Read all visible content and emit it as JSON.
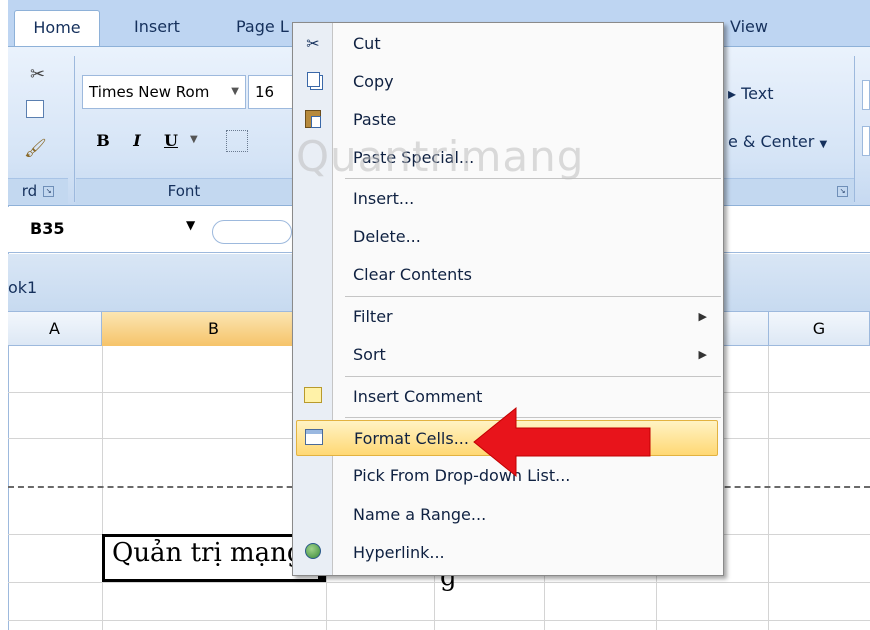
{
  "ribbon": {
    "tabs": [
      "Home",
      "Insert",
      "Page L",
      "View"
    ],
    "font_name": "Times New Rom",
    "font_size": "16",
    "bold_label": "B",
    "italic_label": "I",
    "underline_label": "U",
    "clipboard_group_label": "rd",
    "font_group_label": "Font",
    "wrap_text_fragment": "Text",
    "merge_center_fragment": "e & Center"
  },
  "formula_bar": {
    "name_box": "B35"
  },
  "workbook": {
    "title_fragment": "ok1",
    "columns": [
      "A",
      "B",
      "G"
    ],
    "cell_text": "Quản trị mạng",
    "cell_overflow": "g"
  },
  "context_menu": {
    "items": [
      {
        "label": "Cut",
        "icon": "scissors-icon"
      },
      {
        "label": "Copy",
        "icon": "copy-icon"
      },
      {
        "label": "Paste",
        "icon": "paste-icon"
      },
      {
        "label": "Paste Special...",
        "icon": ""
      },
      {
        "label": "Insert...",
        "icon": ""
      },
      {
        "label": "Delete...",
        "icon": ""
      },
      {
        "label": "Clear Contents",
        "icon": ""
      },
      {
        "label": "Filter",
        "icon": "",
        "submenu": true
      },
      {
        "label": "Sort",
        "icon": "",
        "submenu": true
      },
      {
        "label": "Insert Comment",
        "icon": "comment-icon"
      },
      {
        "label": "Format Cells...",
        "icon": "format-cells-icon",
        "highlighted": true
      },
      {
        "label": "Pick From Drop-down List...",
        "icon": ""
      },
      {
        "label": "Name a Range...",
        "icon": ""
      },
      {
        "label": "Hyperlink...",
        "icon": "hyperlink-icon"
      }
    ]
  },
  "watermark": "Quantrimang",
  "colors": {
    "ribbon_tab_bg": "#bed5f2",
    "menu_highlight": "#ffd874",
    "arrow": "#e8141b",
    "selected_column": "#f6c46a"
  }
}
